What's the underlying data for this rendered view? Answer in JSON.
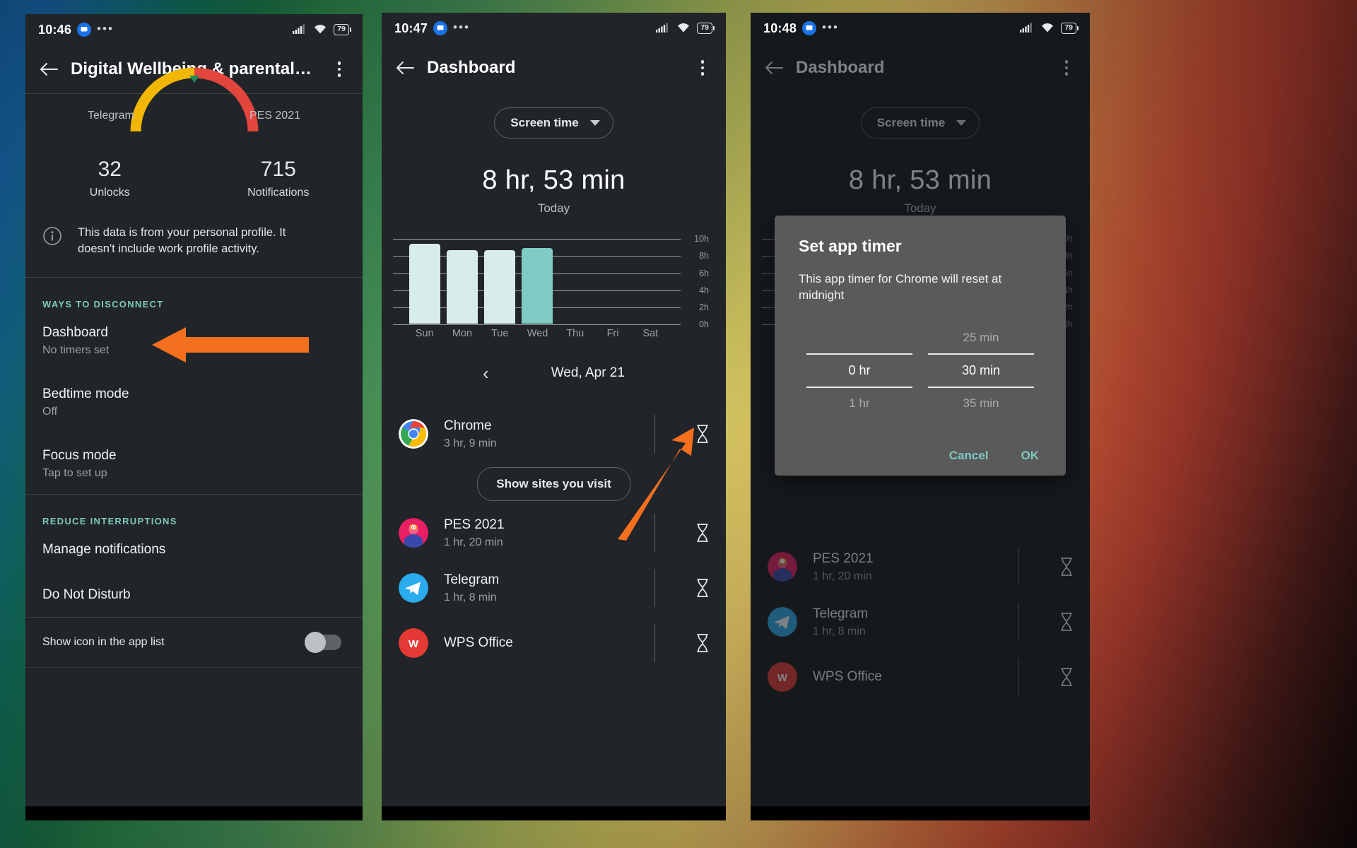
{
  "panel1": {
    "status": {
      "time": "10:46",
      "battery": "79",
      "dots": "•••",
      "chip_icon": "message-icon"
    },
    "appbar": {
      "back_icon": "back-arrow-icon",
      "title": "Digital Wellbeing & parental…",
      "menu_icon": "kebab-menu-icon"
    },
    "donut": {
      "left_label": "Telegram",
      "right_label": "PES 2021"
    },
    "stats": [
      {
        "value": "32",
        "label": "Unlocks"
      },
      {
        "value": "715",
        "label": "Notifications"
      }
    ],
    "note": {
      "icon": "info-icon",
      "text": "This data is from your personal profile. It doesn't include work profile activity."
    },
    "sections": [
      {
        "header": "WAYS TO DISCONNECT",
        "rows": [
          {
            "title": "Dashboard",
            "subtitle": "No timers set"
          },
          {
            "title": "Bedtime mode",
            "subtitle": "Off"
          },
          {
            "title": "Focus mode",
            "subtitle": "Tap to set up"
          }
        ]
      },
      {
        "header": "REDUCE INTERRUPTIONS",
        "rows": [
          {
            "title": "Manage notifications",
            "subtitle": ""
          },
          {
            "title": "Do Not Disturb",
            "subtitle": ""
          }
        ]
      }
    ],
    "toggle_row": {
      "title": "Show icon in the app list",
      "state": "off"
    }
  },
  "panel2": {
    "status": {
      "time": "10:47",
      "battery": "79",
      "dots": "•••",
      "chip_icon": "message-icon"
    },
    "appbar": {
      "back_icon": "back-arrow-icon",
      "title": "Dashboard",
      "menu_icon": "kebab-menu-icon"
    },
    "filter_chip": {
      "label": "Screen time",
      "caret_icon": "chevron-down-icon"
    },
    "total": {
      "value": "8 hr, 53 min",
      "caption": "Today"
    },
    "date_nav": {
      "prev_icon": "chevron-left-icon",
      "date": "Wed, Apr 21"
    },
    "show_sites_button": "Show sites you visit",
    "apps": [
      {
        "name": "Chrome",
        "duration": "3 hr, 9 min",
        "icon": "chrome-icon",
        "timer_icon": "hourglass-icon"
      },
      {
        "name": "PES 2021",
        "duration": "1 hr, 20 min",
        "icon": "pes-icon",
        "timer_icon": "hourglass-icon"
      },
      {
        "name": "Telegram",
        "duration": "1 hr, 8 min",
        "icon": "telegram-icon",
        "timer_icon": "hourglass-icon"
      },
      {
        "name": "WPS Office",
        "duration": "",
        "icon": "wps-icon",
        "timer_icon": "hourglass-icon"
      }
    ]
  },
  "panel3": {
    "status": {
      "time": "10:48",
      "battery": "79",
      "dots": "•••",
      "chip_icon": "message-icon"
    },
    "appbar": {
      "back_icon": "back-arrow-icon",
      "title": "Dashboard",
      "menu_icon": "kebab-menu-icon"
    },
    "filter_chip": {
      "label": "Screen time",
      "caret_icon": "chevron-down-icon"
    },
    "total": {
      "value": "8 hr, 53 min",
      "caption": "Today"
    },
    "dialog": {
      "title": "Set app timer",
      "message": "This app timer for Chrome will reset at midnight",
      "hours": {
        "above": "",
        "selected": "0 hr",
        "below": "1 hr"
      },
      "minutes": {
        "above": "25 min",
        "selected": "30 min",
        "below": "35 min"
      },
      "cancel": "Cancel",
      "ok": "OK"
    },
    "apps": [
      {
        "name": "PES 2021",
        "duration": "1 hr, 20 min",
        "icon": "pes-icon",
        "timer_icon": "hourglass-icon"
      },
      {
        "name": "Telegram",
        "duration": "1 hr, 8 min",
        "icon": "telegram-icon",
        "timer_icon": "hourglass-icon"
      },
      {
        "name": "WPS Office",
        "duration": "",
        "icon": "wps-icon",
        "timer_icon": "hourglass-icon"
      }
    ]
  },
  "chart_data": {
    "type": "bar",
    "title": "Screen time",
    "categories": [
      "Sun",
      "Mon",
      "Tue",
      "Wed",
      "Thu",
      "Fri",
      "Sat"
    ],
    "values": [
      9.4,
      8.6,
      8.6,
      8.9,
      0,
      0,
      0
    ],
    "ytick_labels": [
      "10h",
      "8h",
      "6h",
      "4h",
      "2h",
      "0h"
    ],
    "ytick_values": [
      10,
      8,
      6,
      4,
      2,
      0
    ],
    "ylim": [
      0,
      10.6
    ],
    "xlabel": "",
    "ylabel": "",
    "grid": true,
    "legend": "none",
    "colors": {
      "past": "#d8ecea",
      "today": "#80cbc4"
    },
    "highlight_index": 3
  },
  "colors": {
    "accent_teal": "#7fc8bd",
    "arrow_orange": "#f4701f",
    "surface": "#212529",
    "dialog_surface": "#5a5a5a"
  },
  "annotations": [
    {
      "name": "arrow-to-dashboard",
      "target": "Dashboard row (panel 1)"
    },
    {
      "name": "arrow-to-hourglass",
      "target": "Chrome timer hourglass (panel 2)"
    }
  ]
}
